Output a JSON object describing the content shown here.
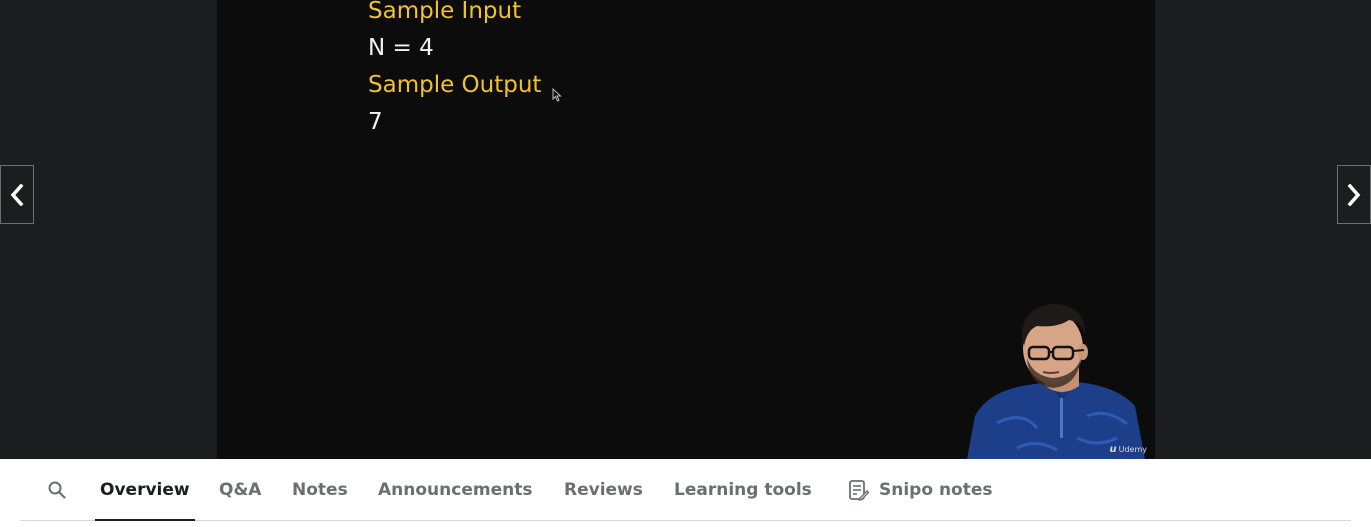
{
  "slide": {
    "sample_input_label": "Sample Input",
    "sample_input_value": "N = 4",
    "sample_output_label": "Sample Output",
    "sample_output_value": "7"
  },
  "watermark": {
    "mark": "u",
    "text": "Udemy"
  },
  "colors": {
    "slide_heading": "#f2c12e",
    "slide_text": "#f2f2f2",
    "video_bg": "#0c0c0c",
    "player_bg": "#1c1d1f",
    "tab_active": "#1c1d1f",
    "tab_inactive": "#6a6f73"
  },
  "icons": {
    "search": "search-icon",
    "prev": "chevron-left-icon",
    "next": "chevron-right-icon",
    "snipo": "notes-icon"
  },
  "tabs": {
    "overview": "Overview",
    "qa": "Q&A",
    "notes": "Notes",
    "announcements": "Announcements",
    "reviews": "Reviews",
    "learning_tools": "Learning tools",
    "snipo_notes": "Snipo notes"
  }
}
